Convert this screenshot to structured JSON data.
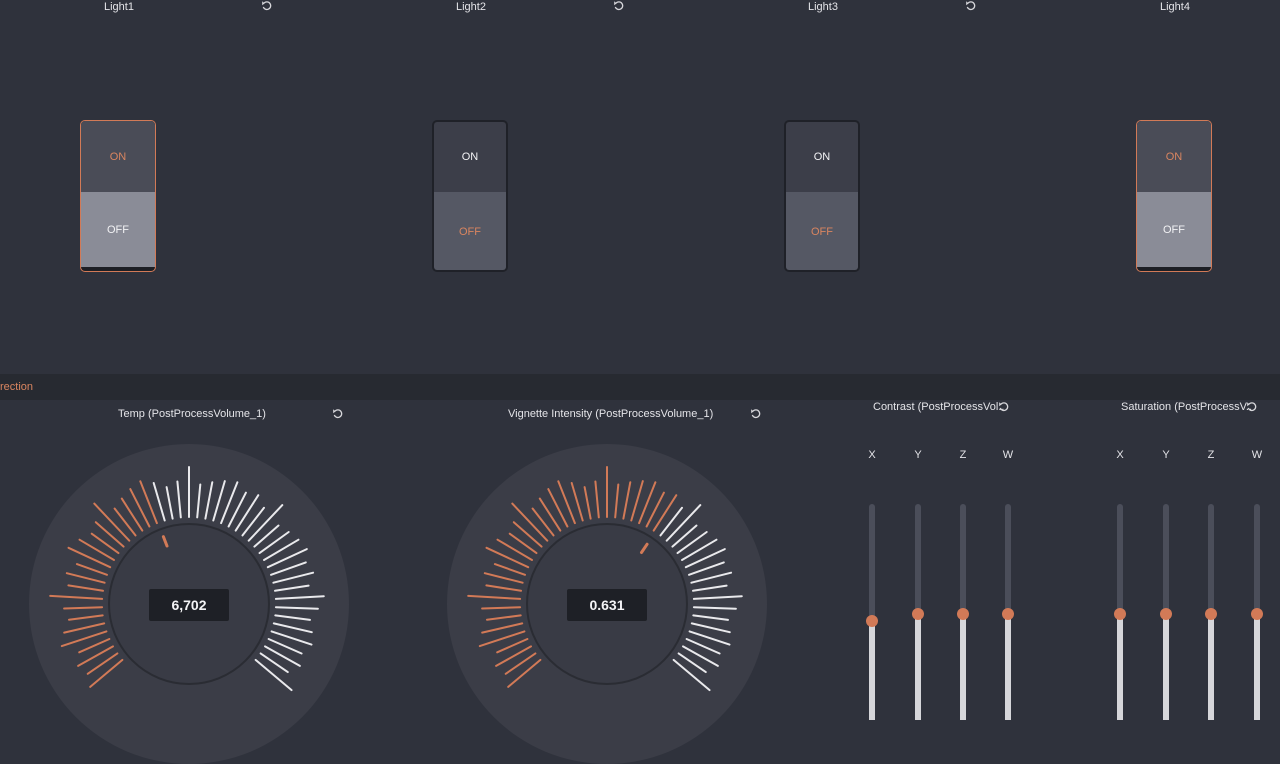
{
  "lights": [
    {
      "label": "Light1",
      "on": "ON",
      "off": "OFF",
      "state": "on"
    },
    {
      "label": "Light2",
      "on": "ON",
      "off": "OFF",
      "state": "off"
    },
    {
      "label": "Light3",
      "on": "ON",
      "off": "OFF",
      "state": "off"
    },
    {
      "label": "Light4",
      "on": "ON",
      "off": "OFF",
      "state": "on"
    }
  ],
  "section": {
    "title": "rection"
  },
  "dials": [
    {
      "label": "Temp (PostProcessVolume_1)",
      "value": "6,702",
      "level": 0.42,
      "accent": "#d27a57"
    },
    {
      "label": "Vignette Intensity (PostProcessVolume_1)",
      "value": "0.631",
      "level": 0.63,
      "accent": "#d27a57"
    }
  ],
  "vectors": [
    {
      "label": "Contrast (PostProcessVol..",
      "axes": [
        "X",
        "Y",
        "Z",
        "W"
      ],
      "levels": [
        0.46,
        0.49,
        0.49,
        0.49
      ]
    },
    {
      "label": "Saturation (PostProcessV..",
      "axes": [
        "X",
        "Y",
        "Z",
        "W"
      ],
      "levels": [
        0.49,
        0.49,
        0.49,
        0.49
      ]
    }
  ],
  "colors": {
    "accent": "#d27a57",
    "background": "#2f323c",
    "tick_light": "#e9e9ec"
  },
  "icons": {
    "reset": "reset-icon"
  }
}
